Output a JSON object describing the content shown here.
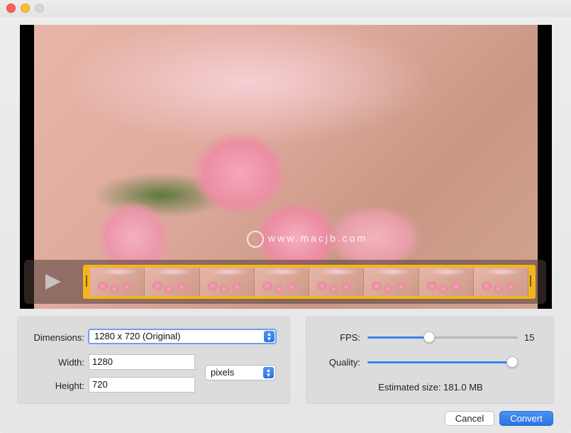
{
  "window": {
    "controls": [
      "close",
      "minimize",
      "zoom"
    ]
  },
  "preview": {
    "watermark": "www.macjb.com",
    "play_icon": "play-icon",
    "thumbnail_count": 8
  },
  "dimensions": {
    "label": "Dimensions:",
    "selected": "1280 x 720 (Original)",
    "width_label": "Width:",
    "width_value": "1280",
    "height_label": "Height:",
    "height_value": "720",
    "unit_selected": "pixels"
  },
  "settings": {
    "fps_label": "FPS:",
    "fps_value": "15",
    "fps_fraction": 0.41,
    "quality_label": "Quality:",
    "quality_fraction": 0.96,
    "estimated_size": "Estimated size: 181.0 MB"
  },
  "buttons": {
    "cancel": "Cancel",
    "convert": "Convert"
  },
  "colors": {
    "accent": "#3a82f0",
    "trim_handle": "#f2b61c"
  }
}
